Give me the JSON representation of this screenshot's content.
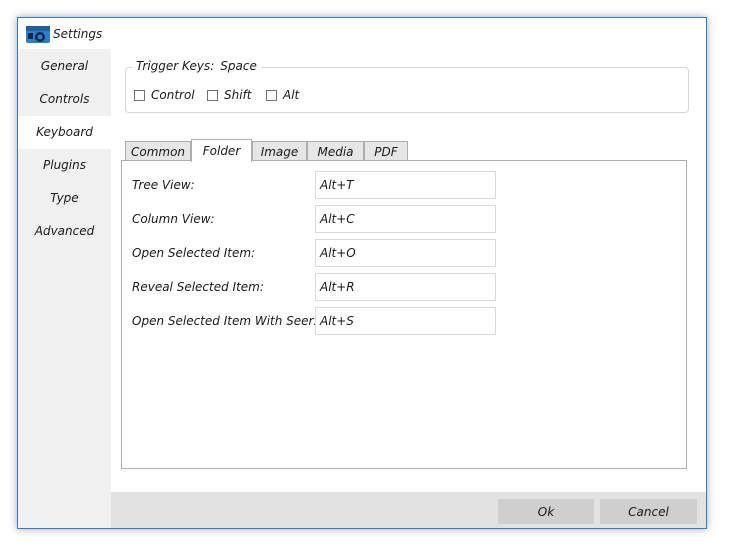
{
  "window": {
    "title": "Settings",
    "app_icon": "camera-eye-icon",
    "accent_color": "#2f7dc8"
  },
  "sidebar": {
    "items": [
      {
        "label": "General",
        "active": false
      },
      {
        "label": "Controls",
        "active": false
      },
      {
        "label": "Keyboard",
        "active": true
      },
      {
        "label": "Plugins",
        "active": false
      },
      {
        "label": "Type",
        "active": false
      },
      {
        "label": "Advanced",
        "active": false
      }
    ]
  },
  "trigger": {
    "label": "Trigger Keys:",
    "value": "Space",
    "modifiers": [
      {
        "label": "Control",
        "checked": false
      },
      {
        "label": "Shift",
        "checked": false
      },
      {
        "label": "Alt",
        "checked": false
      }
    ]
  },
  "tabs": [
    {
      "label": "Common",
      "active": false
    },
    {
      "label": "Folder",
      "active": true
    },
    {
      "label": "Image",
      "active": false
    },
    {
      "label": "Media",
      "active": false
    },
    {
      "label": "PDF",
      "active": false
    }
  ],
  "shortcuts": [
    {
      "label": "Tree View:",
      "value": "Alt+T"
    },
    {
      "label": "Column View:",
      "value": "Alt+C"
    },
    {
      "label": "Open Selected Item:",
      "value": "Alt+O"
    },
    {
      "label": "Reveal Selected Item:",
      "value": "Alt+R"
    },
    {
      "label": "Open Selected Item With Seer:",
      "value": "Alt+S"
    }
  ],
  "footer": {
    "ok_label": "Ok",
    "cancel_label": "Cancel"
  }
}
